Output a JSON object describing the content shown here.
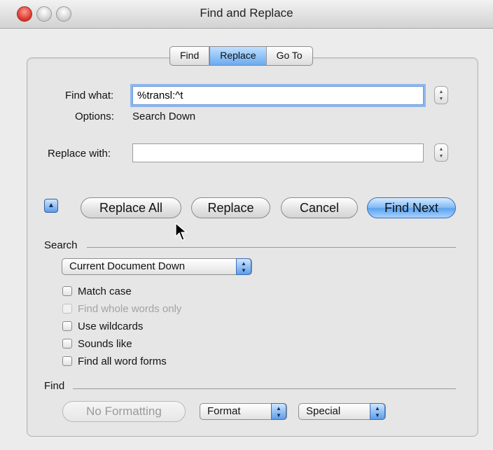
{
  "window": {
    "title": "Find and Replace"
  },
  "tabs": [
    {
      "label": "Find",
      "active": false
    },
    {
      "label": "Replace",
      "active": true
    },
    {
      "label": "Go To",
      "active": false
    }
  ],
  "find": {
    "label": "Find what:",
    "value": "%transl:^t"
  },
  "options": {
    "label": "Options:",
    "value": "Search Down"
  },
  "replace": {
    "label": "Replace with:",
    "value": ""
  },
  "buttons": {
    "collapse_icon": "triangle-up-icon",
    "replace_all": "Replace All",
    "replace": "Replace",
    "cancel": "Cancel",
    "find_next": "Find Next"
  },
  "search": {
    "heading": "Search",
    "direction": "Current Document Down",
    "checkboxes": [
      {
        "label": "Match case",
        "checked": false,
        "enabled": true
      },
      {
        "label": "Find whole words only",
        "checked": false,
        "enabled": false
      },
      {
        "label": "Use wildcards",
        "checked": false,
        "enabled": true
      },
      {
        "label": "Sounds like",
        "checked": false,
        "enabled": true
      },
      {
        "label": "Find all word forms",
        "checked": false,
        "enabled": true
      }
    ]
  },
  "find_section": {
    "heading": "Find",
    "no_formatting": "No Formatting",
    "format": "Format",
    "special": "Special"
  },
  "colors": {
    "accent": "#6aaaf0",
    "default_button": "#5aa2ee"
  }
}
